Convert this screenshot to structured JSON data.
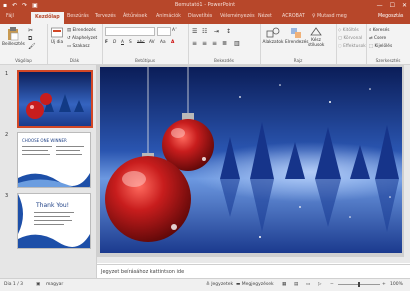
{
  "titlebar": {
    "title": "Bemutató1 - PowerPoint",
    "qat": [
      "save-icon",
      "undo-icon",
      "redo-icon",
      "present-icon"
    ],
    "window_controls": [
      "minimize-icon",
      "maximize-icon",
      "close-icon"
    ]
  },
  "tabs": [
    {
      "label": "Fájl",
      "active": false
    },
    {
      "label": "Kezdőlap",
      "active": true
    },
    {
      "label": "Beszúrás",
      "active": false
    },
    {
      "label": "Tervezés",
      "active": false
    },
    {
      "label": "Áttűnések",
      "active": false
    },
    {
      "label": "Animációk",
      "active": false
    },
    {
      "label": "Diavetítés",
      "active": false
    },
    {
      "label": "Véleményezés",
      "active": false
    },
    {
      "label": "Nézet",
      "active": false
    },
    {
      "label": "ACROBAT",
      "active": false
    },
    {
      "label": "♀ Mutasd meg",
      "active": false
    }
  ],
  "share_label": "Megosztás",
  "ribbon": {
    "clipboard": {
      "label": "Vágólap",
      "paste": "Beillesztés"
    },
    "slides": {
      "label": "Diák",
      "new_slide": "Új dia",
      "layout": "Elrendezés",
      "reset": "Alaphelyzet",
      "section": "Szakasz"
    },
    "font": {
      "label": "Betűtípus",
      "font_name": "",
      "font_size": "",
      "letters": [
        "F",
        "D",
        "A",
        "S",
        "abc",
        "AV",
        "Aa",
        "A"
      ]
    },
    "paragraph": {
      "label": "Bekezdés"
    },
    "drawing": {
      "label": "Rajz",
      "arrange": "Alakzatok",
      "quick_styles": "Elrendezés",
      "styles": "Kész stílusok",
      "fill": "Kitöltés",
      "outline": "Körvonal",
      "effects": "Effektusok"
    },
    "editing": {
      "label": "Szerkesztés",
      "find": "Keresés",
      "replace": "Csere",
      "select": "Kijelölés"
    }
  },
  "thumbnails": [
    {
      "number": "1",
      "selected": true
    },
    {
      "number": "2",
      "selected": false,
      "heading": "CHOOSE ONE WINNER"
    },
    {
      "number": "3",
      "selected": false,
      "heading": "Thank You!"
    }
  ],
  "notes_placeholder": "Jegyzet beírásához kattintson ide",
  "status": {
    "slide_info": "Dia 1 / 3",
    "language": "magyar",
    "notes_btn": "Jegyzetek",
    "comments_btn": "Megjegyzések",
    "zoom": "100%"
  },
  "colors": {
    "accent": "#b7472a",
    "slide_dark": "#0c1f5a",
    "slide_light": "#4f7fd1",
    "ornament": "#c81d1d"
  }
}
